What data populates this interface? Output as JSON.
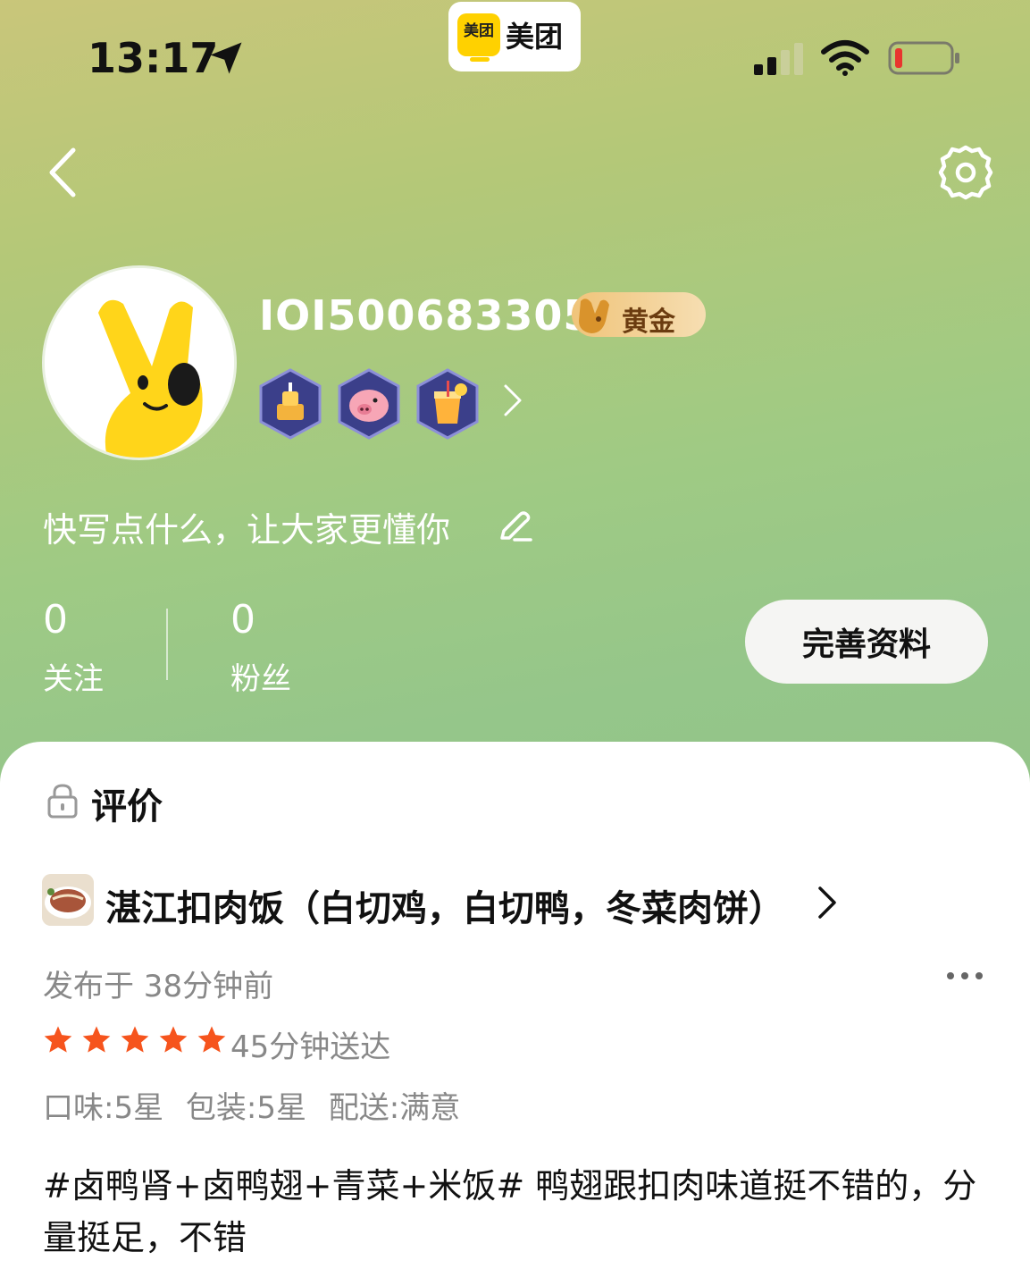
{
  "status_bar": {
    "time": "13:17",
    "icons": [
      "location-arrow-icon",
      "cellular-signal-icon",
      "wifi-icon",
      "battery-low-icon"
    ]
  },
  "app_badge": {
    "mark_text": "美团",
    "name": "美团"
  },
  "nav": {
    "back_icon": "chevron-left-icon",
    "settings_icon": "gear-icon"
  },
  "profile": {
    "username": "IOI500683305",
    "level_badge": "黄金",
    "medals": [
      "cake-medal",
      "piggy-medal",
      "drink-medal"
    ],
    "bio_placeholder": "快写点什么，让大家更懂你",
    "stats": [
      {
        "value": "0",
        "label": "关注"
      },
      {
        "value": "0",
        "label": "粉丝"
      }
    ],
    "edit_button": "完善资料"
  },
  "reviews_section": {
    "title": "评价",
    "review": {
      "shop_name": "湛江扣肉饭（白切鸡，白切鸭，冬菜肉饼）",
      "published": "发布于 38分钟前",
      "stars": 5,
      "delivery_time": "45分钟送达",
      "ratings": [
        "口味:5星",
        "包装:5星",
        "配送:满意"
      ],
      "text": "#卤鸭肾+卤鸭翅+青菜+米饭# 鸭翅跟扣肉味道挺不错的，分量挺足，不错"
    }
  },
  "colors": {
    "header_gradient_top": "#c9c67a",
    "header_gradient_bottom": "#8dbd7f",
    "star": "#f6541d",
    "brand_yellow": "#ffd100"
  }
}
